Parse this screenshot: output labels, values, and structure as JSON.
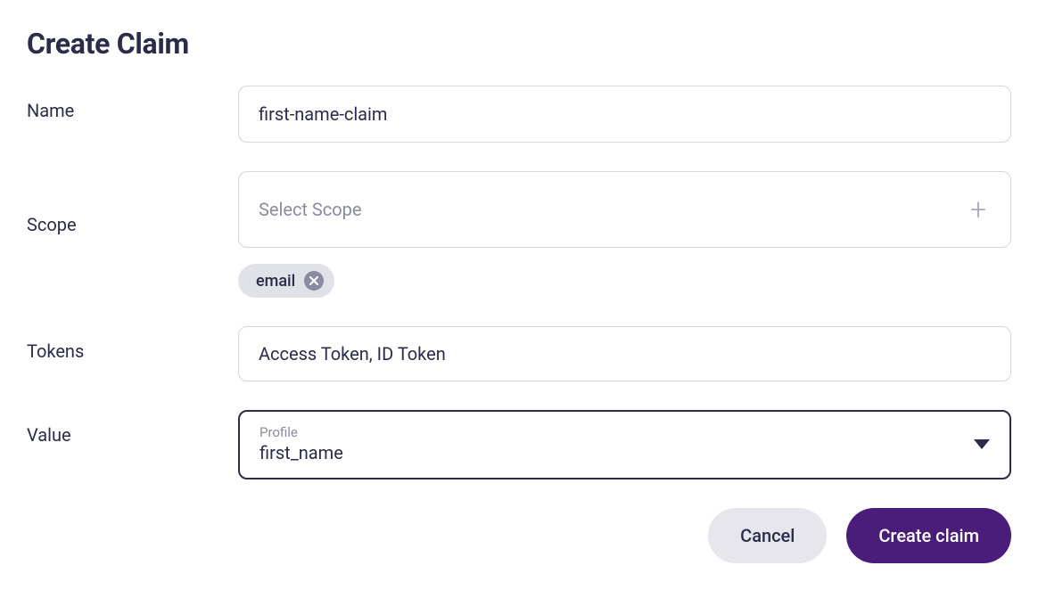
{
  "title": "Create Claim",
  "fields": {
    "name": {
      "label": "Name",
      "value": "first-name-claim"
    },
    "scope": {
      "label": "Scope",
      "placeholder": "Select Scope",
      "chips": [
        {
          "label": "email"
        }
      ]
    },
    "tokens": {
      "label": "Tokens",
      "value": "Access Token,  ID Token"
    },
    "value": {
      "label": "Value",
      "sublabel": "Profile",
      "selected": "first_name"
    }
  },
  "buttons": {
    "cancel": "Cancel",
    "submit": "Create claim"
  }
}
